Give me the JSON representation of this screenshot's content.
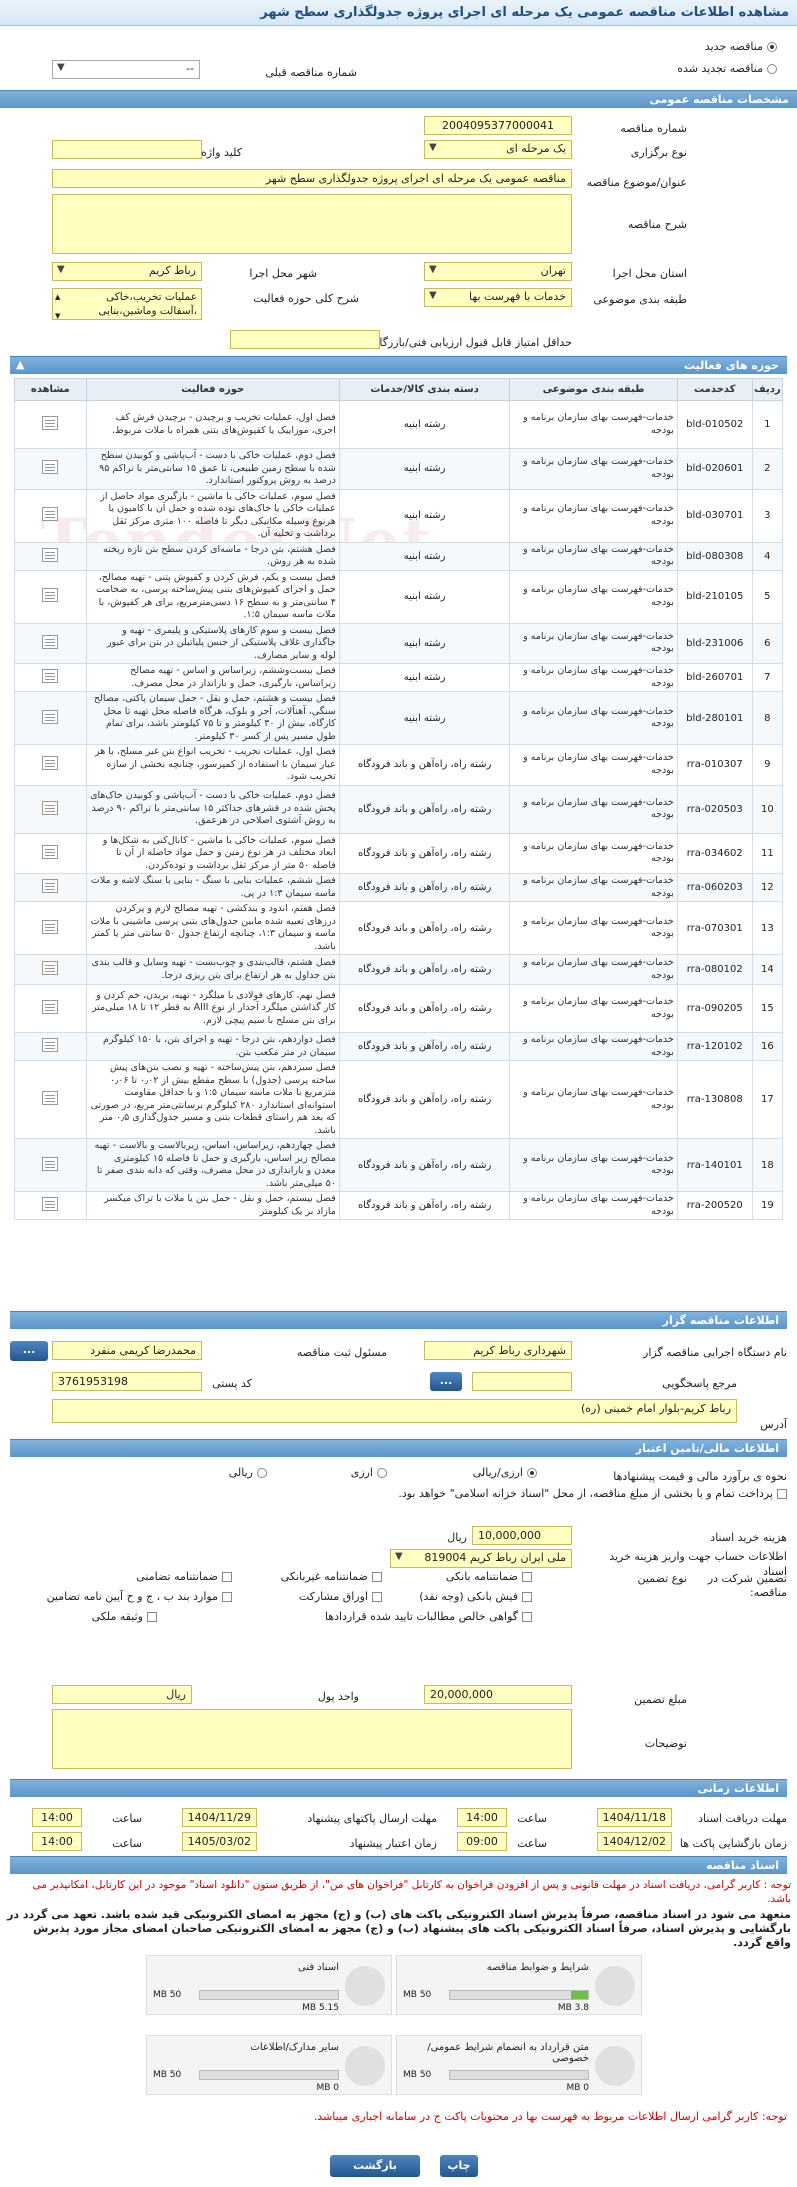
{
  "title": "مشاهده اطلاعات مناقصه عمومی یک مرحله ای اجرای پروژه جدولگذاری سطح شهر",
  "top": {
    "opt_new": "مناقصه جدید",
    "opt_renew": "مناقصه تجدید شده",
    "prev_label": "شماره مناقصه قبلی",
    "prev_value": "--"
  },
  "general": {
    "header": "مشخصات مناقصه عمومی",
    "number_label": "شماره مناقصه",
    "number": "2004095377000041",
    "type_label": "نوع برگزاری",
    "type": "یک مرحله ای",
    "keyword_label": "کلید واژه",
    "keyword": "",
    "subject_label": "عنوان/موضوع مناقصه",
    "subject": "مناقصه عمومی یک مرحله ای اجرای پروژه جدولگذاری سطح شهر",
    "desc_label": "شرح مناقصه",
    "desc": "",
    "province_label": "استان محل اجرا",
    "province": "تهران",
    "city_label": "شهر محل اجرا",
    "city": "رباط کریم",
    "category_label": "طبقه بندی موضوعی",
    "category": "خدمات با فهرست بها",
    "scope_label": "شرح کلی حوزه فعالیت",
    "scope1": "عملیات تخریب،خاکی",
    "scope2": "،آسفالت وماشین،بنایی",
    "min_score_label": "حداقل امتیاز قابل قبول ارزیابی فنی/بازرگانی",
    "min_score": ""
  },
  "activities": {
    "header": "حوزه های فعالیت",
    "cols": [
      "ردیف",
      "کدخدمت",
      "طبقه بندی موضوعی",
      "دسته بندی کالا/خدمات",
      "حوزه فعالیت",
      "مشاهده"
    ],
    "rows": [
      {
        "n": "1",
        "code": "bld-010502",
        "cat": "خدمات-فهرست بهای سازمان برنامه و بودجه",
        "group": "رشته ابنیه",
        "desc": "فصل اول، عملیات تخریب و برچیدن - برچیدن فرش کف اجری، موزاییک یا کفپوش‌های بتنی همراه با ملات مربوط."
      },
      {
        "n": "2",
        "code": "bld-020601",
        "cat": "خدمات-فهرست بهای سازمان برنامه و بودجه",
        "group": "رشته ابنیه",
        "desc": "فصل دوم، عملیات خاکی با دست - آب‌پاشی و کوبیدن سطح شده با سطح زمین طبیعی، تا عمق ۱۵ سانتی‌متر با تراکم ۹۵ درصد به روش پروکتور استاندارد."
      },
      {
        "n": "3",
        "code": "bld-030701",
        "cat": "خدمات-فهرست بهای سازمان برنامه و بودجه",
        "group": "رشته ابنیه",
        "desc": "فصل سوم، عملیات خاکی با ماشین - بارگیری مواد حاصل از عملیات خاکی یا خاک‌های توده شده و حمل آن با کامیون یا هرنوع وسیله مکانیکی دیگر تا فاصله ۱۰۰ متری مرکز ثقل برداشت و تخلیه آن."
      },
      {
        "n": "4",
        "code": "bld-080308",
        "cat": "خدمات-فهرست بهای سازمان برنامه و بودجه",
        "group": "رشته ابنیه",
        "desc": "فصل هشتم، بتن درجا - ماسه‌ای کردن سطح بتن تازه ریخته شده به هر روش."
      },
      {
        "n": "5",
        "code": "bld-210105",
        "cat": "خدمات-فهرست بهای سازمان برنامه و بودجه",
        "group": "رشته ابنیه",
        "desc": "فصل بیست و یکم، فرش کردن و کفپوش بتنی - تهیه مصالح، حمل و اجرای کفپوش‌های بتنی پیش‌ساخته پرسی، به ضخامت ۴ سانتی‌متر و به سطح ۱۶ دسی‌مترمربع، برای هر کفپوش، با ملات ماسه سیمان ۱:۵."
      },
      {
        "n": "6",
        "code": "bld-231006",
        "cat": "خدمات-فهرست بهای سازمان برنامه و بودجه",
        "group": "رشته ابنیه",
        "desc": "فصل بیست و سوم کارهای پلاستیکی و پلیمری - تهیه و جاگذاری غلاف پلاستیکی از جنس پلیاتیلن در بتن برای عبور لوله و سایر مصارف."
      },
      {
        "n": "7",
        "code": "bld-260701",
        "cat": "خدمات-فهرست بهای سازمان برنامه و بودجه",
        "group": "رشته ابنیه",
        "desc": "فصل بیست‌وششم، زیراساس و اساس - تهیه مصالح زیراساس، بارگیری، حمل و بارانداز در محل مصرف."
      },
      {
        "n": "8",
        "code": "bld-280101",
        "cat": "خدمات-فهرست بهای سازمان برنامه و بودجه",
        "group": "رشته ابنیه",
        "desc": "فصل بیست و هشتم، حمل و نقل - حمل سیمان پاکتی، مصالح سنگی، آهنآلات، آجر و بلوک، هرگاه فاصله محل تهیه تا محل کارگاه، بیش از ۳۰ کیلومتر و تا ۷۵ کیلومتر باشد، برای تمام طول مسیر پس از کسر ۳۰ کیلومتر."
      },
      {
        "n": "9",
        "code": "rra-010307",
        "cat": "خدمات-فهرست بهای سازمان برنامه و بودجه",
        "group": "رشته راه، راه‌آهن و باند فرودگاه",
        "desc": "فصل اول، عملیات تخریب - تخریب انواع بتن غیر مسلح، با هر عیار سیمان با استفاده از کمپرسور، چنانچه بخشی از سازه تخریب شود."
      },
      {
        "n": "10",
        "code": "rra-020503",
        "cat": "خدمات-فهرست بهای سازمان برنامه و بودجه",
        "group": "رشته راه، راه‌آهن و باند فرودگاه",
        "desc": "فصل دوم، عملیات خاکی با دست - آب‌پاشی و کوبیدن خاک‌های پخش شده در قشرهای حداکثر ۱۵ سانتی‌متر با تراکم ۹۰ درصد به روش آشتوی اصلاحی در هرعمق."
      },
      {
        "n": "11",
        "code": "rra-034602",
        "cat": "خدمات-فهرست بهای سازمان برنامه و بودجه",
        "group": "رشته راه، راه‌آهن و باند فرودگاه",
        "desc": "فصل سوم، عملیات خاکی با ماشین - کانال‌کنی به شکل‌ها و ابعاد مختلف در هر نوع زمین و حمل مواد حاصله از آن تا فاصله ۵۰ متر از مرکز ثقل برداشت و توده‌کردن."
      },
      {
        "n": "12",
        "code": "rra-060203",
        "cat": "خدمات-فهرست بهای سازمان برنامه و بودجه",
        "group": "رشته راه، راه‌آهن و باند فرودگاه",
        "desc": "فصل ششم، عملیات بنایی با سنگ - بنایی با سنگ لاشه و ملات ماسه سیمان ۱:۳ در پی."
      },
      {
        "n": "13",
        "code": "rra-070301",
        "cat": "خدمات-فهرست بهای سازمان برنامه و بودجه",
        "group": "رشته راه، راه‌آهن و باند فرودگاه",
        "desc": "فصل هفتم، اندود و بندکشی - تهیه مصالح لازم و پرکردن درزهای تعبیه شده مابین جدول‌های بتنی پرسی ماشینی با ملات ماسه و سیمان ۱:۳، چنانچه ارتفاع جدول ۵۰ سانتی متر یا کمتر باشد."
      },
      {
        "n": "14",
        "code": "rra-080102",
        "cat": "خدمات-فهرست بهای سازمان برنامه و بودجه",
        "group": "رشته راه، راه‌آهن و باند فرودگاه",
        "desc": "فصل هشتم، قالب‌بندی و چوب‌بست - تهیه وسایل و قالب بندی بتن جداول به هر ارتفاع برای بتن ریزی درجا."
      },
      {
        "n": "15",
        "code": "rra-090205",
        "cat": "خدمات-فهرست بهای سازمان برنامه و بودجه",
        "group": "رشته راه، راه‌آهن و باند فرودگاه",
        "desc": "فصل نهم، کارهای فولادی با میلگرد - تهیه، بریدن، خم کردن و کار گذاشتن میلگرد آجدار از نوع AIII به قطر ۱۲ تا ۱۸ میلی‌متر برای بتن مسلح با سیم پیچی لازم."
      },
      {
        "n": "16",
        "code": "rra-120102",
        "cat": "خدمات-فهرست بهای سازمان برنامه و بودجه",
        "group": "رشته راه، راه‌آهن و باند فرودگاه",
        "desc": "فصل دوازدهم، بتن درجا - تهیه و اجرای بتن، با ۱۵۰ کیلوگرم سیمان در متر مکعب بتن."
      },
      {
        "n": "17",
        "code": "rra-130808",
        "cat": "خدمات-فهرست بهای سازمان برنامه و بودجه",
        "group": "رشته راه، راه‌آهن و باند فرودگاه",
        "desc": "فصل سیزدهم، بتن پیش‌ساخته - تهیه و نصب بتن‌های پیش ساخته پرسی (جدول) با سطح مقطع بیش از ۰٫۰۲ تا ۰٫۰۶ مترمربع با ملات ماسه سیمان ۱:۵ و با حداقل مقاومت استوانه‌ای استاندارد ۲۸۰ کیلوگرم برسانتی‌متر مربع، در صورتی که بعد هم راستای قطعات بتنی و مسیر جدول‌گذاری ۰٫۵ متر باشد."
      },
      {
        "n": "18",
        "code": "rra-140101",
        "cat": "خدمات-فهرست بهای سازمان برنامه و بودجه",
        "group": "رشته راه، راه‌آهن و باند فرودگاه",
        "desc": "فصل چهاردهم، زیراساس، اساس، زیربالاست و بالاست - تهیه مصالح زیر اساس، بارگیری و حمل تا فاصله ۱۵ کیلومتری معدن و باراندازی در محل مصرف، وقتی که دانه بندی صفر تا ۵۰ میلی‌متر باشد."
      },
      {
        "n": "19",
        "code": "rra-200520",
        "cat": "خدمات-فهرست بهای سازمان برنامه و بودجه",
        "group": "رشته راه، راه‌آهن و باند فرودگاه",
        "desc": "فصل بیستم، حمل و نقل - حمل بتن یا ملات با تراک میکسر مازاد بر یک کیلومتر"
      }
    ]
  },
  "organizer": {
    "header": "اطلاعات مناقصه گزار",
    "org_label": "نام دستگاه اجرایی مناقصه گزار",
    "org": "شهرداری رباط کریم",
    "person_label": "مسئول ثبت مناقصه",
    "person": "محمدرضا کریمی منفرد",
    "ref_label": "مرجع پاسخگویی",
    "postal_label": "کد پستی",
    "postal": "3761953198",
    "addr_label": "آدرس",
    "addr": "رباط کریم-بلوار امام خمینی (ره)",
    "dots": "..."
  },
  "finance": {
    "header": "اطلاعات مالی/تامین اعتبار",
    "estimate_label": "نحوه ی برآورد مالی و قیمت پیشنهادها",
    "opt1": "ارزی/ریالی",
    "opt2": "ارزی",
    "opt3": "ریالی",
    "pay_text": "پرداخت تمام و یا بخشی از مبلغ مناقصه، از محل \"اسناد خزانه اسلامی\" خواهد بود.",
    "doc_cost_label": "هزینه خرید اسناد",
    "doc_cost": "10,000,000",
    "doc_cost_unit": "ریال",
    "acct_label": "اطلاعات حساب جهت واریز هزینه خرید اسناد",
    "acct": "ملی ایران رباط کریم 819004",
    "guar_label": "تضمین شرکت در مناقصه:",
    "guar_type_label": "نوع تضمین",
    "g1": "ضمانتنامه بانکی",
    "g2": "ضمانتنامه غیربانکی",
    "g3": "ضمانتنامه تضامنی",
    "g4": "موارد بند ب ، ج و ح آیین نامه تضامین",
    "g5": "فیش بانکی (وجه نقد)",
    "g6": "اوراق مشارکت",
    "g7": "وثیقه ملکی",
    "g8": "گواهی خالص مطالبات تایید شده قراردادها",
    "amount_label": "مبلغ تضمین",
    "amount": "20,000,000",
    "unit_label": "واحد پول",
    "unit": "ریال",
    "notes_label": "توضیحات"
  },
  "dates": {
    "header": "اطلاعات زمانی",
    "recv_label": "مهلت دریافت اسناد",
    "recv_date": "1404/11/18",
    "recv_time": "14:00",
    "send_label": "مهلت ارسال پاکتهای پیشنهاد",
    "send_date": "1404/11/29",
    "send_time": "14:00",
    "open_label": "زمان بازگشایی پاکت ها",
    "open_date": "1404/12/02",
    "open_time": "09:00",
    "valid_label": "زمان اعتبار پیشنهاد",
    "valid_date": "1405/03/02",
    "valid_time": "14:00",
    "time_label": "ساعت"
  },
  "docs": {
    "header": "اسناد مناقصه",
    "note1": "توجه : کاربر گرامی، دریافت اسناد در مهلت قانونی و پس از افزودن فراخوان به کارتابل \"فراخوان های من\"، از طریق ستون \"دانلود اسناد\" موجود در این کارتابل، امکانپذیر می باشد.",
    "note2": "متعهد می شود در اسناد مناقصه، صرفاً پذیرش اسناد الکترونیکی پاکت های (ب) و (ج) مجهز به امضای الکترونیکی قید شده باشد. تعهد می گردد در بارگشایی و پذیرش اسناد، صرفاً اسناد الکترونیکی پاکت های پیشنهاد (ب) و (ج) مجهز به امضای الکترونیکی صاحبان امضای مجاز مورد پذیرش واقع گردد.",
    "files": [
      {
        "name": "شرایط و ضوابط مناقصه",
        "used": "3.8 MB",
        "max": "50 MB",
        "pct": 0.076
      },
      {
        "name": "اسناد فنی",
        "used": "5.15 MB",
        "max": "50 MB",
        "pct": 0.103
      },
      {
        "name": "متن قرارداد به انضمام شرایط عمومی/خصوصی",
        "used": "0 MB",
        "max": "50 MB",
        "pct": 0
      },
      {
        "name": "سایر مدارک/اطلاعات",
        "used": "0 MB",
        "max": "50 MB",
        "pct": 0
      }
    ],
    "note3": "توجه: کاربر گرامی ارسال اطلاعات مربوط به فهرست بها در محتویات پاکت ج در سامانه اجباری میباشد."
  },
  "buttons": {
    "back": "بازگشت",
    "print": "چاپ"
  },
  "watermark": "TenderNet"
}
